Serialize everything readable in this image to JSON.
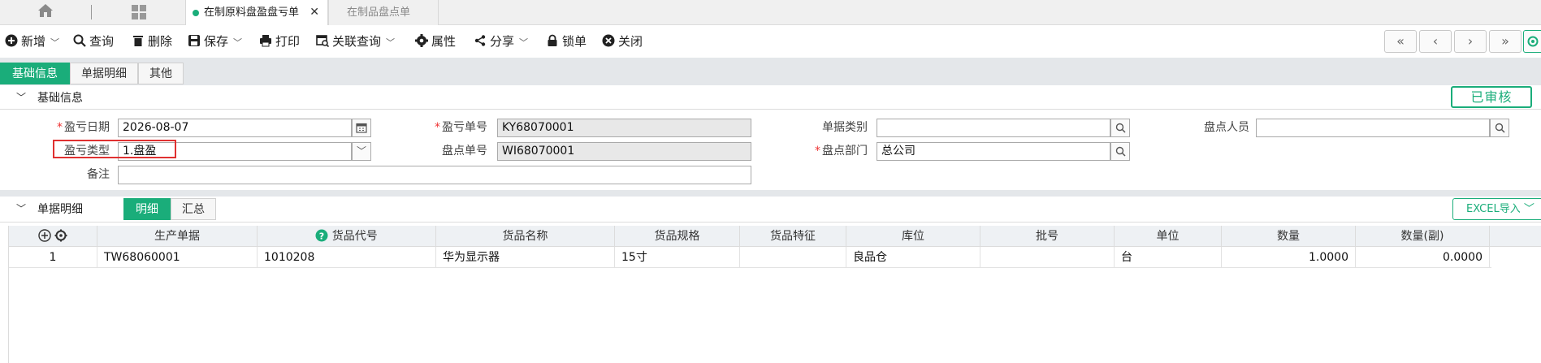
{
  "tabs": {
    "active_label": "在制原料盘盈盘亏单",
    "close_symbol": "✕",
    "inactive_label": "在制品盘点单"
  },
  "toolbar": {
    "new": "新增",
    "query": "查询",
    "delete": "删除",
    "save": "保存",
    "print": "打印",
    "linked_query": "关联查询",
    "attributes": "属性",
    "share": "分享",
    "lock": "锁单",
    "close": "关闭",
    "nav": [
      "«",
      "‹",
      "›",
      "»"
    ]
  },
  "subtabs": [
    "基础信息",
    "单据明细",
    "其他"
  ],
  "basic_section": {
    "title": "基础信息",
    "status": "已审核"
  },
  "form": {
    "date_label": "盈亏日期",
    "date_value": "2026-08-07",
    "type_label": "盈亏类型",
    "type_value": "1.盘盈",
    "remark_label": "备注",
    "remark_value": "",
    "no_label": "盈亏单号",
    "no_value": "KY68070001",
    "count_no_label": "盘点单号",
    "count_no_value": "WI68070001",
    "doc_type_label": "单据类别",
    "doc_type_value": "",
    "dept_label": "盘点部门",
    "dept_value": "总公司",
    "person_label": "盘点人员",
    "person_value": ""
  },
  "detail_section": {
    "title": "单据明细",
    "tab_detail": "明细",
    "tab_summary": "汇总",
    "excel_import": "EXCEL导入"
  },
  "grid": {
    "columns": [
      "生产单据",
      "货品代号",
      "货品名称",
      "货品规格",
      "货品特征",
      "库位",
      "批号",
      "单位",
      "数量",
      "数量(副)"
    ],
    "rows": [
      {
        "index": "1",
        "prod_doc": "TW68060001",
        "item_code": "1010208",
        "item_name": "华为显示器",
        "spec": "15寸",
        "feature": "",
        "location": "良品仓",
        "batch": "",
        "unit": "台",
        "qty": "1.0000",
        "qty2": "0.0000"
      }
    ]
  },
  "colors": {
    "accent": "#1aad7a",
    "highlight_border": "#e03131"
  }
}
